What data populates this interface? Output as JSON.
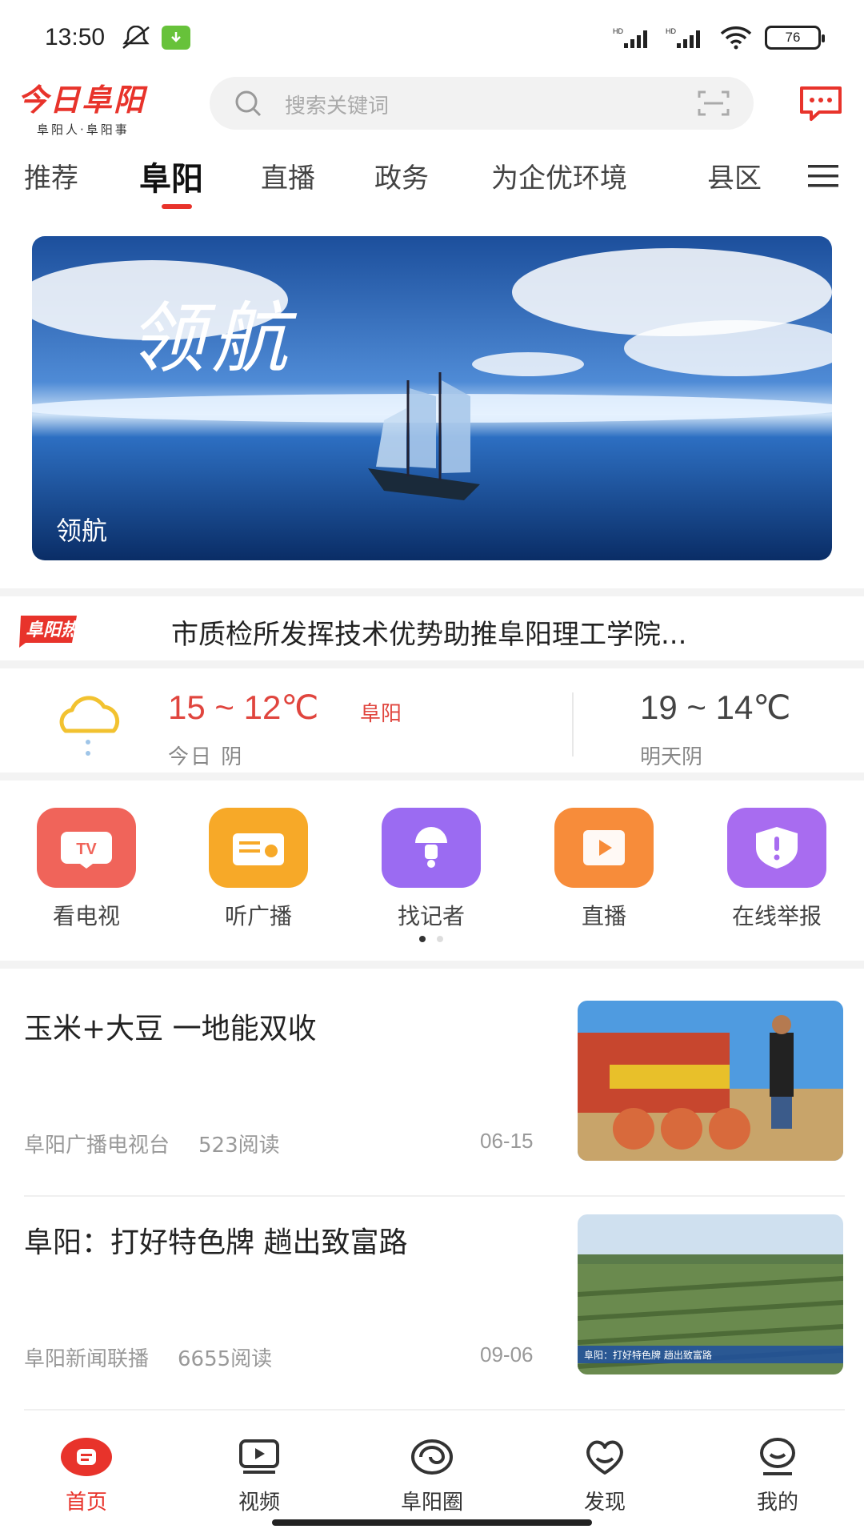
{
  "status": {
    "time": "13:50",
    "battery": "76"
  },
  "header": {
    "logo_main": "今日阜阳",
    "logo_sub": "阜阳人·阜阳事",
    "search_placeholder": "搜索关键词"
  },
  "tabs": [
    "推荐",
    "阜阳",
    "直播",
    "政务",
    "为企优环境",
    "县区"
  ],
  "active_tab": "阜阳",
  "banner": {
    "title": "领航",
    "caption": "领航"
  },
  "hot": {
    "badge": "阜阳热点",
    "title": "市质检所发挥技术优势助推阜阳理工学院..."
  },
  "weather": {
    "today_temp": "15 ~ 12℃",
    "city": "阜阳",
    "today_desc": "今日 阴",
    "tomorrow_temp": "19 ~ 14℃",
    "tomorrow_desc": "明天阴"
  },
  "quick": [
    {
      "label": "看电视",
      "icon": "tv-icon",
      "color": "#f0645a"
    },
    {
      "label": "听广播",
      "icon": "radio-icon",
      "color": "#f7a928"
    },
    {
      "label": "找记者",
      "icon": "reporter-icon",
      "color": "#9b6bf2"
    },
    {
      "label": "直播",
      "icon": "live-icon",
      "color": "#f78c3a"
    },
    {
      "label": "在线举报",
      "icon": "report-icon",
      "color": "#a86cf0"
    }
  ],
  "news": [
    {
      "title": "玉米+大豆 一地能双收",
      "source": "阜阳广播电视台",
      "reads": "523阅读",
      "date": "06-15"
    },
    {
      "title": "阜阳：打好特色牌 趟出致富路",
      "source": "阜阳新闻联播",
      "reads": "6655阅读",
      "date": "09-06",
      "thumb_caption": "阜阳：打好特色牌 趟出致富路"
    }
  ],
  "nav": [
    {
      "label": "首页",
      "icon": "home-icon"
    },
    {
      "label": "视频",
      "icon": "video-icon"
    },
    {
      "label": "阜阳圈",
      "icon": "circle-icon"
    },
    {
      "label": "发现",
      "icon": "discover-icon"
    },
    {
      "label": "我的",
      "icon": "profile-icon"
    }
  ],
  "colors": {
    "accent": "#e8332b",
    "weather_today": "#e0453e"
  }
}
